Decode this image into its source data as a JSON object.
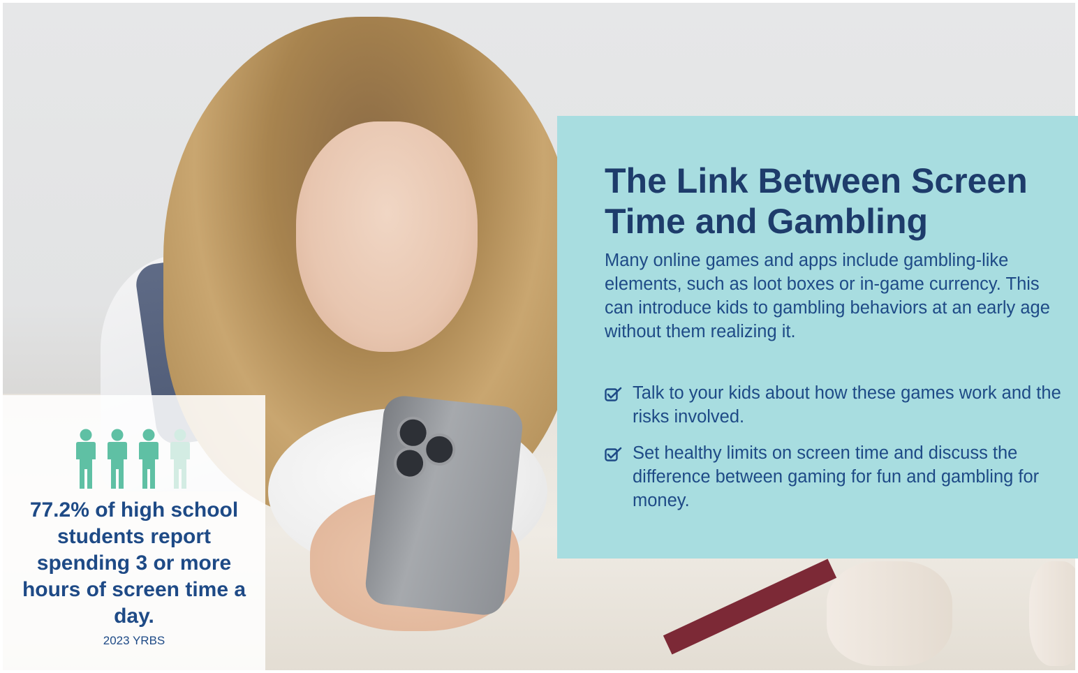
{
  "panel": {
    "title": "The Link Between Screen Time and Gambling",
    "intro": "Many online games and apps include gambling-like elements, such as loot boxes or in-game currency. This can introduce kids to gambling behaviors at an early age without them realizing it.",
    "tips": [
      {
        "icon": "checkbox-icon",
        "text": "Talk to your kids about how these games work and the risks involved."
      },
      {
        "icon": "checkbox-icon",
        "text": "Set healthy limits on screen time and discuss the difference between gaming for fun and gambling for money."
      }
    ],
    "accent_color": "#a8dde0",
    "title_color": "#1e3c6b",
    "text_color": "#1e4a86"
  },
  "stat": {
    "icon": "people-icon",
    "filled_fraction": 0.772,
    "icon_color": "#5fc0a4",
    "icon_faded_color": "#d3ece3",
    "text": "77.2% of high school students report spending 3 or more hours of screen time a day.",
    "source": "2023 YRBS"
  }
}
